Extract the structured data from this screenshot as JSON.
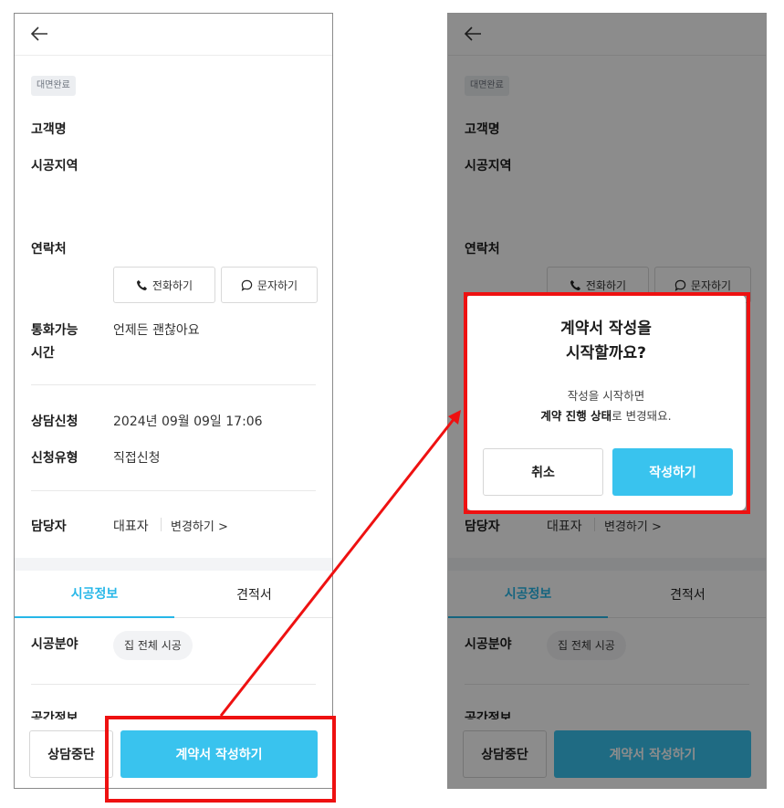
{
  "colors": {
    "accent": "#39c3ee",
    "tab_active": "#27b7e8",
    "highlight": "#ee1111",
    "overlay": "rgba(0,0,0,0.45)"
  },
  "icons": {
    "back": "arrow-left-icon",
    "phone": "phone-icon",
    "message": "chat-bubble-icon",
    "chevron": "chevron-right-icon"
  },
  "detail": {
    "status_badge": "대면완료",
    "customer_label": "고객명",
    "region_label": "시공지역",
    "contact_label": "연락처",
    "call_button": "전화하기",
    "message_button": "문자하기",
    "available_label_line1": "통화가능",
    "available_label_line2": "시간",
    "available_value": "언제든 괜찮아요",
    "request_label": "상담신청",
    "request_value": "2024년 09월 09일 17:06",
    "type_label": "신청유형",
    "type_value": "직접신청",
    "manager_label": "담당자",
    "manager_value": "대표자",
    "change_link": "변경하기 >"
  },
  "tabs": [
    {
      "label": "시공정보",
      "active": true
    },
    {
      "label": "견적서",
      "active": false
    }
  ],
  "construction": {
    "field_label": "시공분야",
    "field_chip": "집 전체 시공",
    "space_label": "공간정보"
  },
  "bottom": {
    "stop_button": "상담중단",
    "write_button": "계약서 작성하기"
  },
  "modal": {
    "title_line1": "계약서 작성을",
    "title_line2": "시작할까요?",
    "desc_line1": "작성을 시작하면",
    "desc_bold": "계약 진행 상태",
    "desc_rest": "로 변경돼요.",
    "cancel_button": "취소",
    "confirm_button": "작성하기"
  }
}
